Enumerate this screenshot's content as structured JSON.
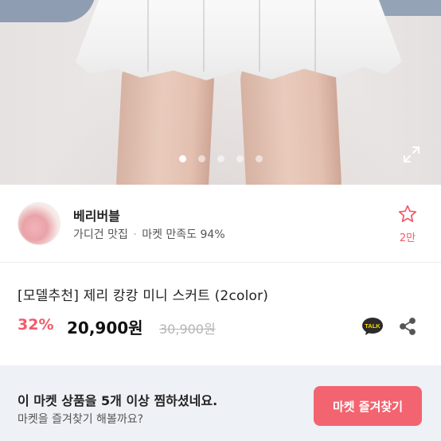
{
  "gallery": {
    "slide_count": 5,
    "active_index": 0,
    "image": "white-ruffle-mini-skirt-photo",
    "expand_icon": "expand-icon"
  },
  "shop": {
    "name": "베리버블",
    "category": "가디건 맛집",
    "separator": "·",
    "satisfaction_label": "마켓 만족도 94%",
    "favorite_icon": "star-outline-icon",
    "favorite_count": "2만"
  },
  "product": {
    "title": "[모델추천] 제리 캉캉 미니 스커트 (2color)",
    "discount": "32%",
    "price": "20,900원",
    "original_price": "30,900원",
    "talk_icon": "kakaotalk-icon",
    "talk_label": "TALK",
    "share_icon": "share-icon"
  },
  "banner": {
    "line1": "이 마켓 상품을 5개 이상 찜하셨네요.",
    "line2": "마켓을 즐겨찾기 해볼까요?",
    "button_label": "마켓 즐겨찾기"
  },
  "colors": {
    "accent": "#f25a6a",
    "banner_bg": "#eef1f6",
    "button_bg": "#f26470",
    "talk_bg": "#2b2b2b",
    "talk_text": "#ffd800"
  }
}
